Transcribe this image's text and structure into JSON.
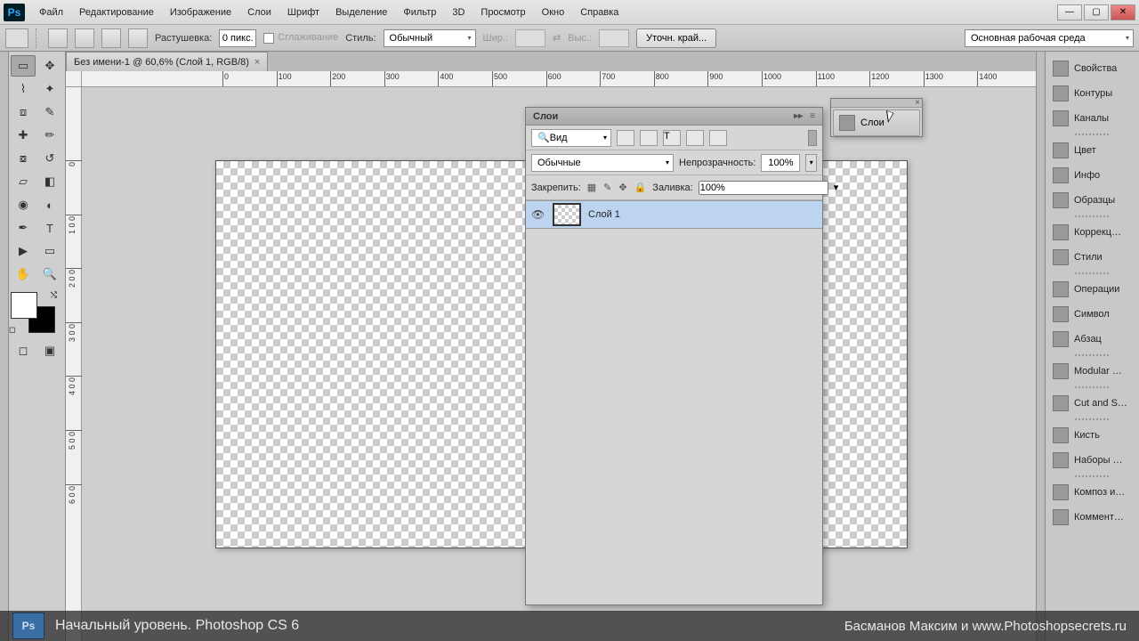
{
  "menubar": [
    "Файл",
    "Редактирование",
    "Изображение",
    "Слои",
    "Шрифт",
    "Выделение",
    "Фильтр",
    "3D",
    "Просмотр",
    "Окно",
    "Справка"
  ],
  "optbar": {
    "feather_label": "Растушевка:",
    "feather_value": "0 пикс.",
    "antialias_label": "Сглаживание",
    "style_label": "Стиль:",
    "style_value": "Обычный",
    "width_label": "Шир.:",
    "height_label": "Выс.:",
    "refine_label": "Уточн. край...",
    "workspace": "Основная рабочая среда"
  },
  "document_tab": "Без имени-1 @ 60,6% (Слой 1, RGB/8)",
  "ruler_ticks": [
    100,
    200,
    300,
    400,
    500,
    600,
    700,
    800,
    900,
    1000,
    1100,
    1200,
    1300,
    1400
  ],
  "ruler_zero": "0",
  "vruler_ticks": [
    "0",
    "1 0 0",
    "2 0 0",
    "3 0 0",
    "4 0 0",
    "5 0 0",
    "6 0 0"
  ],
  "layers_panel": {
    "title": "Слои",
    "view_label": "Вид",
    "blend_mode": "Обычные",
    "opacity_label": "Непрозрачность:",
    "opacity_value": "100%",
    "lock_label": "Закрепить:",
    "fill_label": "Заливка:",
    "fill_value": "100%",
    "layer_name": "Слой 1"
  },
  "collapsed_dock": {
    "label": "Слои"
  },
  "side_panels": {
    "group1": [
      "Свойства",
      "Контуры",
      "Каналы"
    ],
    "group2": [
      "Цвет",
      "Инфо",
      "Образцы"
    ],
    "group3": [
      "Коррекц…",
      "Стили"
    ],
    "group4": [
      "Операции",
      "Символ",
      "Абзац"
    ],
    "group5": [
      "Modular …"
    ],
    "group6": [
      "Cut and S…"
    ],
    "group7": [
      "Кисть",
      "Наборы …"
    ],
    "group8": [
      "Композ и…",
      "Коммент…"
    ]
  },
  "overlay": {
    "left": "Начальный уровень. Photoshop CS 6",
    "right": "Басманов Максим и www.Photoshopsecrets.ru"
  }
}
